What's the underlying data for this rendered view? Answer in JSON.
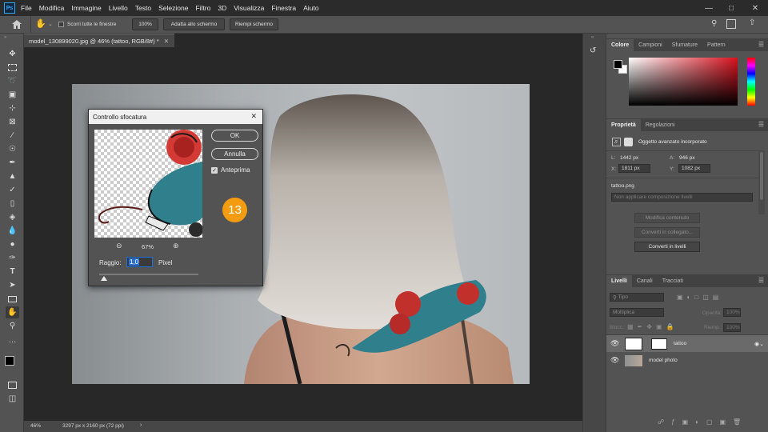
{
  "app": {
    "logo": "Ps"
  },
  "menu": [
    "File",
    "Modifica",
    "Immagine",
    "Livello",
    "Testo",
    "Selezione",
    "Filtro",
    "3D",
    "Visualizza",
    "Finestra",
    "Aiuto"
  ],
  "options": {
    "scroll_all_label": "Scorri tutte le finestre",
    "zoom_100": "100%",
    "fit_screen": "Adatta allo schermo",
    "fill_screen": "Riempi schermo"
  },
  "document": {
    "tab_title": "model_130899020.jpg @ 46% (tattoo, RGB/8#) *",
    "zoom": "46%",
    "size_info": "3297 px x 2160 px (72 ppi)"
  },
  "dialog": {
    "title": "Controllo sfocatura",
    "ok": "OK",
    "cancel": "Annulla",
    "preview_label": "Anteprima",
    "preview_checked": true,
    "preview_zoom": "67%",
    "radius_label": "Raggio:",
    "radius_value": "1,0",
    "radius_unit": "Pixel",
    "slider_fraction": 0.05
  },
  "step_badge": "13",
  "color_panel": {
    "tabs": [
      "Colore",
      "Campioni",
      "Sfumature",
      "Pattern"
    ],
    "active": "Colore",
    "hue_color": "#d9121f"
  },
  "properties": {
    "tabs": [
      "Proprietà",
      "Regolazioni"
    ],
    "active": "Proprietà",
    "object_type": "Oggetto avanzato incorporato",
    "L": "1442 px",
    "A": "946 px",
    "X": "1811 px",
    "Y": "1082 px",
    "filename": "tattoo.png",
    "comp_placeholder": "Non applicare composizione livelli",
    "btn_edit": "Modifica contenuto",
    "btn_convert_linked": "Converti in collegato...",
    "btn_convert_layers": "Converti in livelli"
  },
  "layers_panel": {
    "tabs": [
      "Livelli",
      "Canali",
      "Tracciati"
    ],
    "active": "Livelli",
    "filter_placeholder": "Tipo",
    "blend_mode": "Moltiplica",
    "opacity_label": "Opacità:",
    "opacity_value": "100%",
    "lock_label": "Blocc.:",
    "fill_label": "Riemp.:",
    "fill_value": "100%",
    "layers": [
      {
        "name": "tattoo",
        "selected": true
      },
      {
        "name": "model photo",
        "selected": false
      }
    ]
  },
  "colors": {
    "accent": "#31a8ff",
    "badge": "#f39c12",
    "swatch_fg": "#000000",
    "swatch_bg": "#ffffff"
  }
}
